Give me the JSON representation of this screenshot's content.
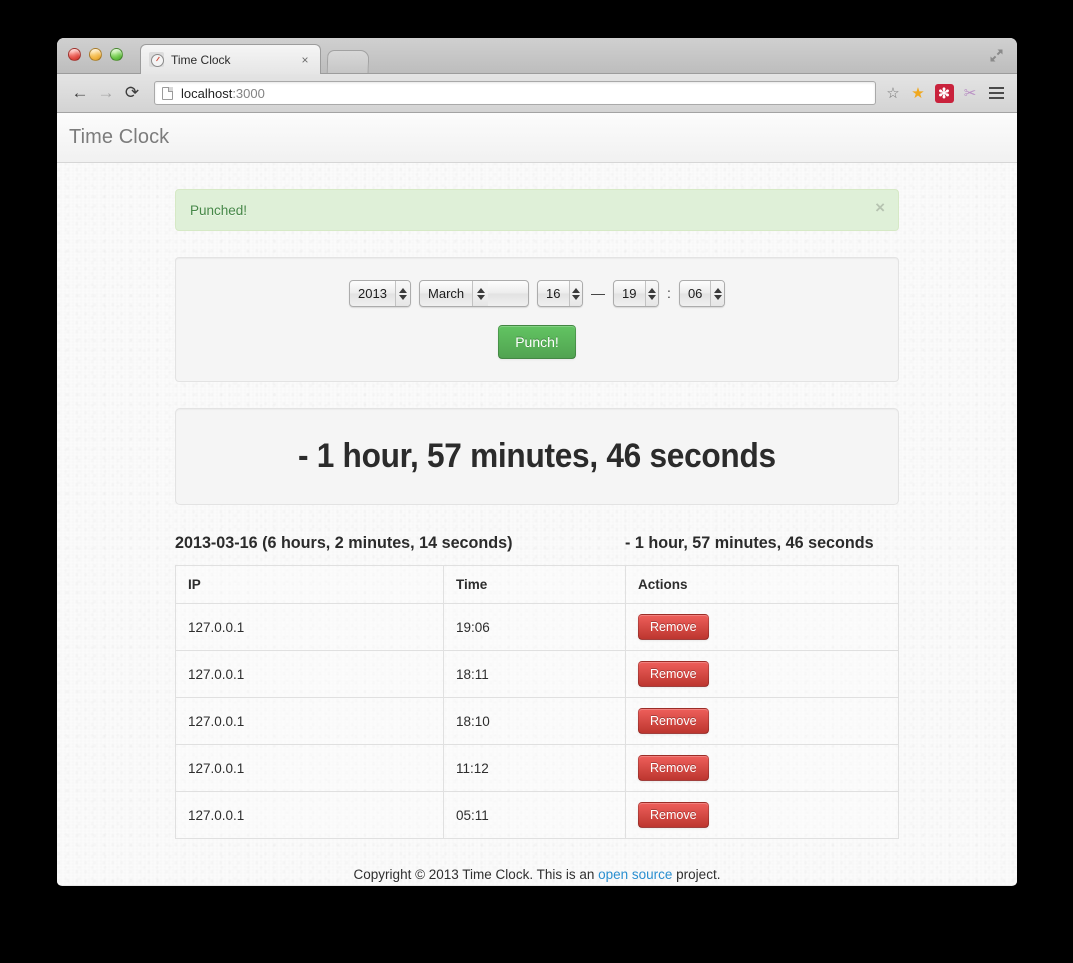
{
  "browser": {
    "tab": {
      "title": "Time Clock",
      "favicon": "clock-favicon",
      "close": "×"
    },
    "newtab_label": "",
    "nav": {
      "back": "←",
      "forward": "→",
      "reload": "⟳"
    },
    "omnibox": {
      "host": "localhost",
      "port": ":3000",
      "full": "localhost:3000",
      "bookmark_star": "☆"
    },
    "extensions": [
      {
        "name": "star-extension-icon",
        "glyph": "★"
      },
      {
        "name": "asterisk-extension-icon",
        "glyph": "✻"
      },
      {
        "name": "scissors-extension-icon",
        "glyph": "✂"
      }
    ],
    "menu_label": "",
    "window_expand": "expand-icon"
  },
  "app": {
    "brand": "Time Clock",
    "alert": {
      "message": "Punched!",
      "close": "×"
    },
    "form": {
      "year": "2013",
      "month": "March",
      "day": "16",
      "date_time_separator": "—",
      "hour": "19",
      "time_separator": ":",
      "minute": "06",
      "submit_label": "Punch!"
    },
    "hero": {
      "total": "- 1 hour, 57 minutes, 46 seconds"
    },
    "section": {
      "day_heading": "2013-03-16 (6 hours, 2 minutes, 14 seconds)",
      "balance_heading": "- 1 hour, 57 minutes, 46 seconds"
    },
    "table": {
      "columns": [
        "IP",
        "Time",
        "Actions"
      ],
      "action_label": "Remove",
      "rows": [
        {
          "ip": "127.0.0.1",
          "time": "19:06",
          "action": "Remove"
        },
        {
          "ip": "127.0.0.1",
          "time": "18:11",
          "action": "Remove"
        },
        {
          "ip": "127.0.0.1",
          "time": "18:10",
          "action": "Remove"
        },
        {
          "ip": "127.0.0.1",
          "time": "11:12",
          "action": "Remove"
        },
        {
          "ip": "127.0.0.1",
          "time": "05:11",
          "action": "Remove"
        }
      ]
    },
    "footer": {
      "before": "Copyright © 2013 Time Clock. This is an ",
      "link": "open source",
      "after": " project."
    }
  },
  "colors": {
    "success_bg": "#dff0d8",
    "success_text": "#468847",
    "punch_button": "#51a351",
    "remove_button": "#bd362f",
    "link": "#2a8fd0",
    "brand_text": "#7c7c7c"
  }
}
